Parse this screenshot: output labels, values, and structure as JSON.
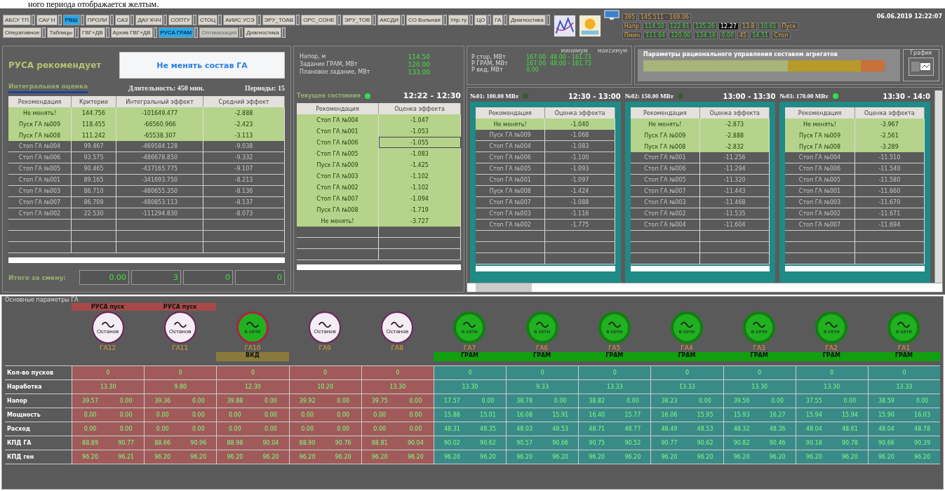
{
  "caption": "ного периода отображается желтым.",
  "toolbar": {
    "row1": [
      {
        "label": "АБСУ ТП",
        "selected": false,
        "disabled": false
      },
      {
        "label": "САУ Н",
        "selected": false,
        "disabled": false
      },
      {
        "label": "РВШ",
        "selected": true,
        "disabled": false
      },
      {
        "label": "ПРОЛИ",
        "selected": false,
        "disabled": false
      },
      {
        "label": "САЗ",
        "selected": false,
        "disabled": false
      },
      {
        "label": "ДАУ КЧЧ",
        "selected": false,
        "disabled": false
      },
      {
        "label": "СОПТУ",
        "selected": false,
        "disabled": false
      },
      {
        "label": "СТОЦ",
        "selected": false,
        "disabled": false
      },
      {
        "label": "АИИС УСЭ",
        "selected": false,
        "disabled": false
      },
      {
        "label": "ЭРУ_ТОАВ",
        "selected": false,
        "disabled": false
      },
      {
        "label": "ОРС_СОНЕ",
        "selected": false,
        "disabled": false
      },
      {
        "label": "ЭРУ_ТОВ",
        "selected": false,
        "disabled": false
      },
      {
        "label": "АКСДИ",
        "selected": false,
        "disabled": false
      },
      {
        "label": "СО Вольная",
        "selected": false,
        "disabled": false
      },
      {
        "label": "Упр.ту",
        "selected": false,
        "disabled": false
      },
      {
        "label": "ЦО",
        "selected": false,
        "disabled": false
      },
      {
        "label": "ГА",
        "selected": false,
        "disabled": false
      },
      {
        "label": "Диагностика",
        "selected": false,
        "disabled": false
      }
    ],
    "row2": [
      {
        "label": "Оперативное",
        "selected": false,
        "disabled": false
      },
      {
        "label": "Таблицы",
        "selected": false,
        "disabled": false
      },
      {
        "label": "ГВГ+ДВ",
        "selected": false,
        "disabled": false
      },
      {
        "label": "Архив ГВГ+ДВ",
        "selected": false,
        "disabled": false
      },
      {
        "label": "РУСА ГРАМ",
        "selected": true,
        "disabled": false
      },
      {
        "label": "Оптимизация",
        "selected": false,
        "disabled": true
      },
      {
        "label": "Диагностика",
        "selected": false,
        "disabled": false
      }
    ]
  },
  "status": {
    "datetime": "06.06.2019 12:22:07",
    "rows": [
      [
        {
          "text": "395",
          "kind": "label"
        },
        {
          "text": "145.511 - 169.06",
          "kind": "label"
        }
      ],
      [
        {
          "text": "Напр",
          "kind": "label"
        },
        {
          "text": "114.50",
          "kind": "value"
        },
        {
          "text": "122.61",
          "kind": "value"
        },
        {
          "text": "135.26",
          "kind": "value"
        },
        {
          "text": "12.27",
          "kind": "dark"
        },
        {
          "text": "13.8",
          "kind": "label"
        },
        {
          "text": "10.61",
          "kind": "value"
        },
        {
          "text": "Пуск",
          "kind": "label"
        }
      ],
      [
        {
          "text": "Пмин",
          "kind": "label"
        },
        {
          "text": "111.64",
          "kind": "value"
        },
        {
          "text": "120.00",
          "kind": "value"
        },
        {
          "text": "134.16",
          "kind": "value"
        },
        {
          "text": "0.00",
          "kind": "value"
        },
        {
          "text": "45",
          "kind": "label"
        },
        {
          "text": "14.51",
          "kind": "value"
        },
        {
          "text": "Стоп",
          "kind": "label"
        }
      ]
    ]
  },
  "recommendation": {
    "label": "РУСА рекомендует",
    "action": "Не менять состав ГА"
  },
  "integral": {
    "tab": "Интегральная оценка",
    "duration": "Длительность: 450 мин.",
    "periods": "Периоды: 15",
    "columns": [
      "Рекомендация",
      "Критерии",
      "Интегральный эффект",
      "Средний эффект"
    ],
    "rows": [
      {
        "cells": [
          "Не менять!",
          "144.756",
          "-101649.477",
          "-2.888"
        ],
        "recommended": true
      },
      {
        "cells": [
          "Пуск ГА №009",
          "118.455",
          "-66560.966",
          "-2.423"
        ],
        "recommended": true
      },
      {
        "cells": [
          "Пуск ГА №008",
          "111.242",
          "-65538.307",
          "-3.113"
        ],
        "recommended": true
      },
      {
        "cells": [
          "Стоп ГА №004",
          "99.467",
          "-469584.128",
          "-9.038"
        ],
        "recommended": false
      },
      {
        "cells": [
          "Стоп ГА №006",
          "93.575",
          "-486678.850",
          "-9.332"
        ],
        "recommended": false
      },
      {
        "cells": [
          "Стоп ГА №005",
          "90.465",
          "-437165.775",
          "-9.107"
        ],
        "recommended": false
      },
      {
        "cells": [
          "Стоп ГА №001",
          "89.165",
          "-341693.750",
          "-8.213"
        ],
        "recommended": false
      },
      {
        "cells": [
          "Стоп ГА №003",
          "86.710",
          "-480655.350",
          "-8.136"
        ],
        "recommended": false
      },
      {
        "cells": [
          "Стоп ГА №007",
          "86.709",
          "-480853.113",
          "-8.137"
        ],
        "recommended": false
      },
      {
        "cells": [
          "Стоп ГА №002",
          "22.530",
          "-111294.830",
          "-8.073"
        ],
        "recommended": false
      }
    ],
    "total_label": "Итого за смену:",
    "totals": [
      "0.00",
      "3",
      "0",
      "0"
    ]
  },
  "current": {
    "params": [
      {
        "label": "Напор, м",
        "value": "114.50"
      },
      {
        "label": "Задание ГРАМ, МВт",
        "value": "120.00"
      },
      {
        "label": "Плановое задание, МВт",
        "value": "133.00"
      }
    ],
    "title": "Текущее состояние",
    "active": true,
    "time": "12:22 - 12:30",
    "columns": [
      "Рекомендация",
      "Оценка эффекта"
    ],
    "rows": [
      {
        "cells": [
          "Стоп ГА №004",
          "-1.047"
        ],
        "focused": false
      },
      {
        "cells": [
          "Стоп ГА №001",
          "-1.053"
        ],
        "focused": false
      },
      {
        "cells": [
          "Стоп ГА №006",
          "-1.055"
        ],
        "focused": true
      },
      {
        "cells": [
          "Стоп ГА №005",
          "-1.083"
        ],
        "focused": false
      },
      {
        "cells": [
          "Пуск ГА №009",
          "-1.425"
        ],
        "focused": false
      },
      {
        "cells": [
          "Стоп ГА №003",
          "-1.102"
        ],
        "focused": false
      },
      {
        "cells": [
          "Стоп ГА №002",
          "-1.102"
        ],
        "focused": false
      },
      {
        "cells": [
          "Стоп ГА №007",
          "-1.094"
        ],
        "focused": false
      },
      {
        "cells": [
          "Пуск ГА №008",
          "-1.719"
        ],
        "focused": false
      },
      {
        "cells": [
          "Не менять!",
          "-3.727"
        ],
        "focused": false
      }
    ]
  },
  "power": {
    "headers": [
      "минимум",
      "максимум"
    ],
    "rows": [
      {
        "label": "P стор, МВт",
        "value": "167.00",
        "range": "48.00 - 161.73"
      },
      {
        "label": "P ГРАМ, МВт",
        "value": "167.00",
        "range": "48.00 - 161.73"
      },
      {
        "label": "P вкд, МВт",
        "value": "0.00"
      }
    ]
  },
  "params_panel": {
    "title": "Параметры рационального управления составом агрегатов",
    "segments": [
      {
        "color": "#a8b47a"
      },
      {
        "color": "#b89a2a"
      },
      {
        "color": "#c8703a"
      }
    ],
    "graph_label": "График"
  },
  "periods": [
    {
      "title": "№01: 100.00 МВт",
      "time": "12:30 - 13:00",
      "active": false,
      "columns": [
        "Рекомендация",
        "Оценка эффекта"
      ],
      "rows": [
        {
          "cells": [
            "Не менять!",
            "-1.040"
          ],
          "recommended": true
        },
        {
          "cells": [
            "Пуск ГА №009",
            "-1.068"
          ],
          "recommended": false
        },
        {
          "cells": [
            "Стоп ГА №004",
            "-1.083"
          ],
          "recommended": false
        },
        {
          "cells": [
            "Стоп ГА №006",
            "-1.100"
          ],
          "recommended": false
        },
        {
          "cells": [
            "Стоп ГА №005",
            "-1.093"
          ],
          "recommended": false
        },
        {
          "cells": [
            "Стоп ГА №001",
            "-1.097"
          ],
          "recommended": false
        },
        {
          "cells": [
            "Пуск ГА №008",
            "-1.424"
          ],
          "recommended": false
        },
        {
          "cells": [
            "Стоп ГА №007",
            "-1.088"
          ],
          "recommended": false
        },
        {
          "cells": [
            "Стоп ГА №003",
            "-1.116"
          ],
          "recommended": false
        },
        {
          "cells": [
            "Стоп ГА №002",
            "-1.775"
          ],
          "recommended": false
        }
      ]
    },
    {
      "title": "№02: 150.00 МВт",
      "time": "13:00 - 13:30",
      "active": false,
      "columns": [
        "Рекомендация",
        "Оценка эффекта"
      ],
      "rows": [
        {
          "cells": [
            "Не менять!",
            "-2.873"
          ],
          "recommended": true
        },
        {
          "cells": [
            "Пуск ГА №009",
            "-2.888"
          ],
          "recommended": true
        },
        {
          "cells": [
            "Пуск ГА №008",
            "-2.832"
          ],
          "recommended": true
        },
        {
          "cells": [
            "Стоп ГА №001",
            "-11.256"
          ],
          "recommended": false
        },
        {
          "cells": [
            "Стоп ГА №006",
            "-11.294"
          ],
          "recommended": false
        },
        {
          "cells": [
            "Стоп ГА №005",
            "-11.320"
          ],
          "recommended": false
        },
        {
          "cells": [
            "Стоп ГА №007",
            "-11.443"
          ],
          "recommended": false
        },
        {
          "cells": [
            "Стоп ГА №003",
            "-11.468"
          ],
          "recommended": false
        },
        {
          "cells": [
            "Стоп ГА №002",
            "-11.535"
          ],
          "recommended": false
        },
        {
          "cells": [
            "Стоп ГА №004",
            "-11.604"
          ],
          "recommended": false
        }
      ]
    },
    {
      "title": "№03: 170.00 МВт",
      "time": "13:30 - 14:0",
      "active": true,
      "columns": [
        "Рекомендация",
        "Оценка эффекта"
      ],
      "rows": [
        {
          "cells": [
            "Не менять!",
            "-3.967"
          ],
          "recommended": true
        },
        {
          "cells": [
            "Пуск ГА №009",
            "-2.561"
          ],
          "recommended": true
        },
        {
          "cells": [
            "Пуск ГА №008",
            "-3.289"
          ],
          "recommended": true
        },
        {
          "cells": [
            "Стоп ГА №004",
            "-11.510"
          ],
          "recommended": false
        },
        {
          "cells": [
            "Стоп ГА №006",
            "-11.540"
          ],
          "recommended": false
        },
        {
          "cells": [
            "Стоп ГА №005",
            "-11.580"
          ],
          "recommended": false
        },
        {
          "cells": [
            "Стоп ГА №001",
            "-11.660"
          ],
          "recommended": false
        },
        {
          "cells": [
            "Стоп ГА №003",
            "-11.670"
          ],
          "recommended": false
        },
        {
          "cells": [
            "Стоп ГА №002",
            "-11.671"
          ],
          "recommended": false
        },
        {
          "cells": [
            "Стоп ГА №007",
            "-11.694"
          ],
          "recommended": false
        }
      ]
    }
  ],
  "units_section": {
    "title": "Основные параметры ГА",
    "units": [
      {
        "name": "ГА12",
        "running": false,
        "alarm": false,
        "badge": "РУСА пуск",
        "state": "Останов"
      },
      {
        "name": "ГА11",
        "running": false,
        "alarm": false,
        "badge": "РУСА пуск",
        "state": "Останов"
      },
      {
        "name": "ГА10",
        "running": true,
        "alarm": true,
        "mode": {
          "text": "ВКД",
          "kind": "vkd"
        },
        "state": "в сети"
      },
      {
        "name": "ГА9",
        "running": false,
        "alarm": false,
        "state": "Останов"
      },
      {
        "name": "ГА8",
        "running": false,
        "alarm": false,
        "state": "Останов"
      },
      {
        "name": "ГА7",
        "running": true,
        "alarm": false,
        "mode": {
          "text": "ГРАМ",
          "kind": "gram"
        },
        "state": "в сети"
      },
      {
        "name": "ГА6",
        "running": true,
        "alarm": false,
        "mode": {
          "text": "ГРАМ",
          "kind": "gram"
        },
        "state": "в сети"
      },
      {
        "name": "ГА5",
        "running": true,
        "alarm": false,
        "mode": {
          "text": "ГРАМ",
          "kind": "gram"
        },
        "state": "в сети"
      },
      {
        "name": "ГА4",
        "running": true,
        "alarm": false,
        "mode": {
          "text": "ГРАМ",
          "kind": "gram"
        },
        "state": "в сети"
      },
      {
        "name": "ГА3",
        "running": true,
        "alarm": false,
        "mode": {
          "text": "ГРАМ",
          "kind": "gram"
        },
        "state": "в сети"
      },
      {
        "name": "ГА2",
        "running": true,
        "alarm": false,
        "mode": {
          "text": "ГРАМ",
          "kind": "gram"
        },
        "state": "в сети"
      },
      {
        "name": "ГА1",
        "running": true,
        "alarm": false,
        "mode": {
          "text": "ГРАМ",
          "kind": "gram"
        },
        "state": "в сети"
      }
    ],
    "rows": [
      {
        "label": "Кол-во пусков",
        "cells": [
          [
            "0"
          ],
          [
            "0"
          ],
          [
            "0"
          ],
          [
            "0"
          ],
          [
            "0"
          ],
          [
            "0"
          ],
          [
            "0"
          ],
          [
            "0"
          ],
          [
            "0"
          ],
          [
            "0"
          ],
          [
            "0"
          ],
          [
            "0"
          ]
        ]
      },
      {
        "label": "Наработка",
        "cells": [
          [
            "13.30"
          ],
          [
            "9.80"
          ],
          [
            "12.30"
          ],
          [
            "10.20"
          ],
          [
            "13.30"
          ],
          [
            "13.30"
          ],
          [
            "9.33"
          ],
          [
            "13.33"
          ],
          [
            "13.33"
          ],
          [
            "13.30"
          ],
          [
            "13.30"
          ],
          [
            "13.33"
          ]
        ]
      },
      {
        "label": "Напор",
        "cells": [
          [
            "39.57",
            "0.00"
          ],
          [
            "39.36",
            "0.00"
          ],
          [
            "39.88",
            "0.00"
          ],
          [
            "39.92",
            "0.00"
          ],
          [
            "39.75",
            "0.00"
          ],
          [
            "17.57",
            "0.00"
          ],
          [
            "38.78",
            "0.00"
          ],
          [
            "38.82",
            "0.00"
          ],
          [
            "38.23",
            "0.00"
          ],
          [
            "39.56",
            "0.00"
          ],
          [
            "37.55",
            "0.00"
          ],
          [
            "38.59",
            "0.00"
          ]
        ]
      },
      {
        "label": "Мощность",
        "cells": [
          [
            "0.00",
            "0.00"
          ],
          [
            "0.00",
            "0.00"
          ],
          [
            "0.00",
            "0.00"
          ],
          [
            "0.00",
            "0.00"
          ],
          [
            "0.00",
            "0.00"
          ],
          [
            "15.88",
            "15.01"
          ],
          [
            "16.08",
            "15.91"
          ],
          [
            "16.40",
            "15.77"
          ],
          [
            "16.06",
            "15.95"
          ],
          [
            "15.93",
            "16.27"
          ],
          [
            "15.94",
            "15.94"
          ],
          [
            "15.90",
            "16.03"
          ]
        ]
      },
      {
        "label": "Расход",
        "cells": [
          [
            "0.00",
            "0.00"
          ],
          [
            "0.00",
            "0.00"
          ],
          [
            "0.00",
            "0.00"
          ],
          [
            "0.00",
            "0.00"
          ],
          [
            "0.00",
            "0.00"
          ],
          [
            "48.31",
            "48.35"
          ],
          [
            "48.03",
            "48.53"
          ],
          [
            "48.71",
            "48.77"
          ],
          [
            "48.49",
            "48.53"
          ],
          [
            "48.32",
            "48.36"
          ],
          [
            "48.04",
            "48.61"
          ],
          [
            "48.04",
            "48.78"
          ]
        ]
      },
      {
        "label": "КПД ГА",
        "cells": [
          [
            "88.89",
            "90.77"
          ],
          [
            "88.66",
            "90.96"
          ],
          [
            "88.98",
            "90.04"
          ],
          [
            "88.90",
            "90.76"
          ],
          [
            "88.81",
            "90.04"
          ],
          [
            "90.02",
            "90.62"
          ],
          [
            "90.57",
            "90.66"
          ],
          [
            "90.75",
            "90.52"
          ],
          [
            "90.77",
            "90.62"
          ],
          [
            "90.82",
            "90.46"
          ],
          [
            "90.18",
            "90.78"
          ],
          [
            "90.66",
            "90.39"
          ]
        ]
      },
      {
        "label": "КПД ген",
        "cells": [
          [
            "96.20",
            "96.21"
          ],
          [
            "96.20",
            "96.20"
          ],
          [
            "96.20",
            "96.20"
          ],
          [
            "96.20",
            "96.20"
          ],
          [
            "96.20",
            "96.20"
          ],
          [
            "96.20",
            "96.20"
          ],
          [
            "96.20",
            "96.20"
          ],
          [
            "96.20",
            "96.20"
          ],
          [
            "96.20",
            "96.20"
          ],
          [
            "96.20",
            "96.20"
          ],
          [
            "96.20",
            "96.20"
          ],
          [
            "96.20",
            "96.20"
          ]
        ]
      }
    ]
  }
}
